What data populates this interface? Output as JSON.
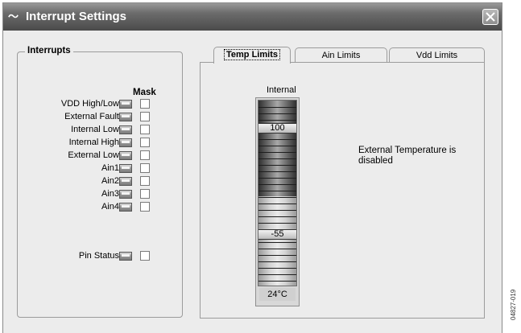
{
  "window": {
    "title": "Interrupt Settings"
  },
  "interrupts": {
    "legend": "Interrupts",
    "mask_header": "Mask",
    "rows": [
      {
        "label": "VDD High/Low",
        "masked": false
      },
      {
        "label": "External Fault",
        "masked": false
      },
      {
        "label": "Internal Low",
        "masked": false
      },
      {
        "label": "Internal High",
        "masked": false
      },
      {
        "label": "External Low",
        "masked": false
      },
      {
        "label": "Ain1",
        "masked": false
      },
      {
        "label": "Ain2",
        "masked": false
      },
      {
        "label": "Ain3",
        "masked": false
      },
      {
        "label": "Ain4",
        "masked": false
      }
    ],
    "pin_status": {
      "label": "Pin Status",
      "masked": false
    }
  },
  "tabs": [
    {
      "label": "Temp Limits",
      "active": true
    },
    {
      "label": "Ain Limits",
      "active": false
    },
    {
      "label": "Vdd Limits",
      "active": false
    }
  ],
  "temp_limits": {
    "internal_label": "Internal",
    "high_limit": "100",
    "low_limit": "-55",
    "current_temp": "24°C",
    "external_message": "External Temperature is disabled"
  },
  "figure_id": "04827-019"
}
